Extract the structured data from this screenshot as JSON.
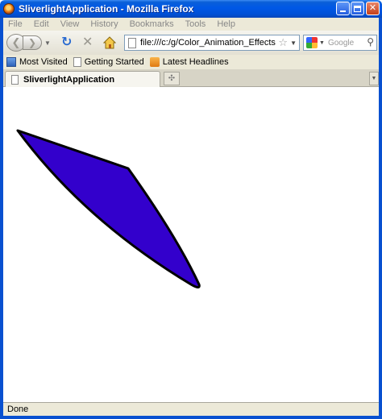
{
  "window": {
    "title": "SliverlightApplication - Mozilla Firefox",
    "icon": "firefox-icon"
  },
  "menu": [
    "File",
    "Edit",
    "View",
    "History",
    "Bookmarks",
    "Tools",
    "Help"
  ],
  "navbar": {
    "url": "file:///c:/g/Color_Animation_Effects/Bin/Det",
    "search_placeholder": "Google"
  },
  "bookmarks": [
    {
      "label": "Most Visited",
      "icon": "bookmark-star-icon"
    },
    {
      "label": "Getting Started",
      "icon": "page-icon"
    },
    {
      "label": "Latest Headlines",
      "icon": "rss-feed-icon"
    }
  ],
  "tab": {
    "title": "SliverlightApplication"
  },
  "content": {
    "shape_fill": "#3300cc",
    "shape_stroke": "#000000"
  },
  "status": {
    "text": "Done"
  }
}
